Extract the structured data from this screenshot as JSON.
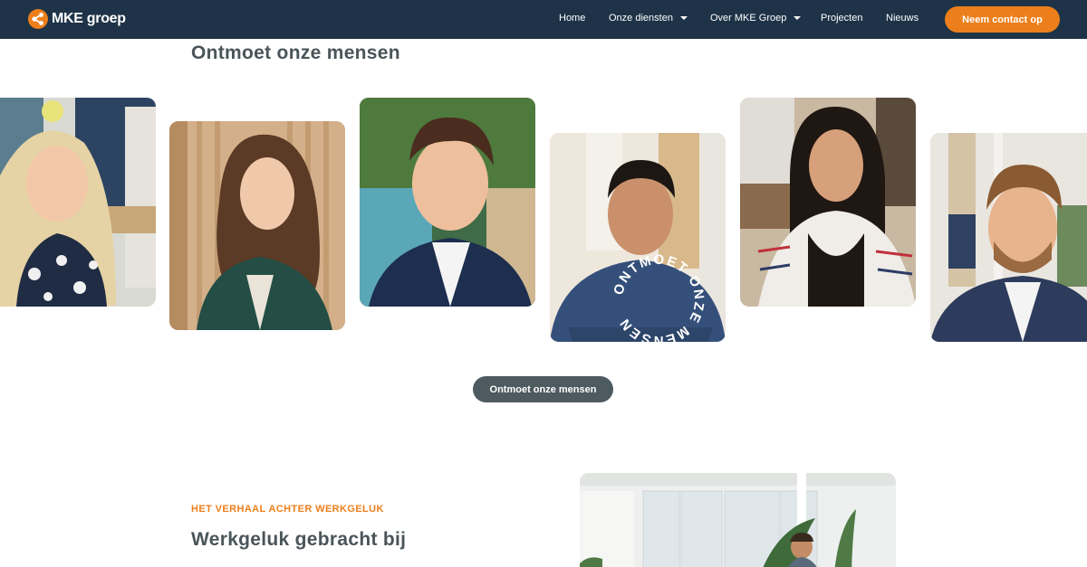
{
  "brand": {
    "name": "MKE groep",
    "logo_icon": "share-node-icon",
    "accent": "#ec7f1b",
    "navy": "#1e3347"
  },
  "nav": {
    "items": [
      {
        "label": "Home",
        "has_dropdown": false
      },
      {
        "label": "Onze diensten",
        "has_dropdown": true
      },
      {
        "label": "Over MKE Groep",
        "has_dropdown": true
      },
      {
        "label": "Projecten",
        "has_dropdown": false
      },
      {
        "label": "Nieuws",
        "has_dropdown": false
      }
    ],
    "cta_label": "Neem contact op"
  },
  "team": {
    "title": "Ontmoet onze mensen",
    "badge_text": "ONTMOET ONZE MENSEN",
    "button_label": "Ontmoet onze mensen"
  },
  "werkgeluk": {
    "eyebrow": "HET VERHAAL ACHTER WERKGELUK",
    "title": "Werkgeluk gebracht bij"
  }
}
